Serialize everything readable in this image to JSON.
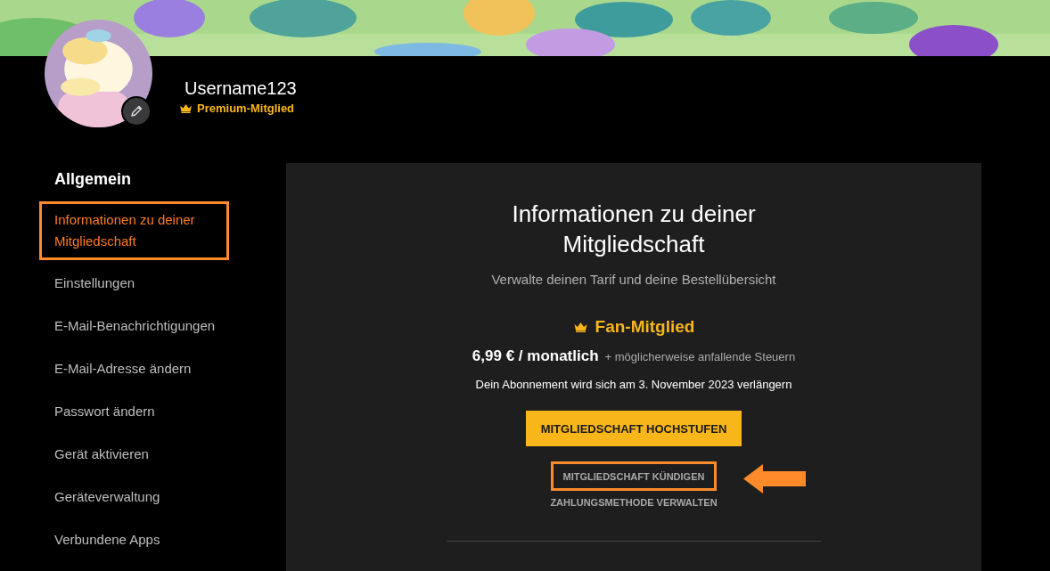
{
  "profile": {
    "username": "Username123",
    "badge": "Premium-Mitglied"
  },
  "sidebar": {
    "heading": "Allgemein",
    "items": [
      {
        "label": "Informationen zu deiner Mitgliedschaft",
        "selected": true,
        "highlighted": true
      },
      {
        "label": "Einstellungen",
        "selected": false,
        "highlighted": false
      },
      {
        "label": "E-Mail-Benachrichtigungen",
        "selected": false,
        "highlighted": false
      },
      {
        "label": "E-Mail-Adresse ändern",
        "selected": false,
        "highlighted": false
      },
      {
        "label": "Passwort ändern",
        "selected": false,
        "highlighted": false
      },
      {
        "label": "Gerät aktivieren",
        "selected": false,
        "highlighted": false
      },
      {
        "label": "Geräteverwaltung",
        "selected": false,
        "highlighted": false
      },
      {
        "label": "Verbundene Apps",
        "selected": false,
        "highlighted": false
      }
    ]
  },
  "membership": {
    "title": "Informationen zu deiner Mitgliedschaft",
    "subtitle": "Verwalte deinen Tarif und deine Bestellübersicht",
    "plan": "Fan-Mitglied",
    "price": "6,99 € / monatlich",
    "tax_note": "+ möglicherweise anfallende Steuern",
    "renewal": "Dein Abonnement wird sich am 3. November 2023 verlängern",
    "actions": [
      {
        "kind": "button",
        "label": "MITGLIEDSCHAFT HOCHSTUFEN"
      },
      {
        "kind": "link",
        "label": "MITGLIEDSCHAFT KÜNDIGEN",
        "highlighted": true,
        "arrow": true
      },
      {
        "kind": "link",
        "label": "ZAHLUNGSMETHODE VERWALTEN",
        "highlighted": false,
        "arrow": false
      }
    ]
  }
}
